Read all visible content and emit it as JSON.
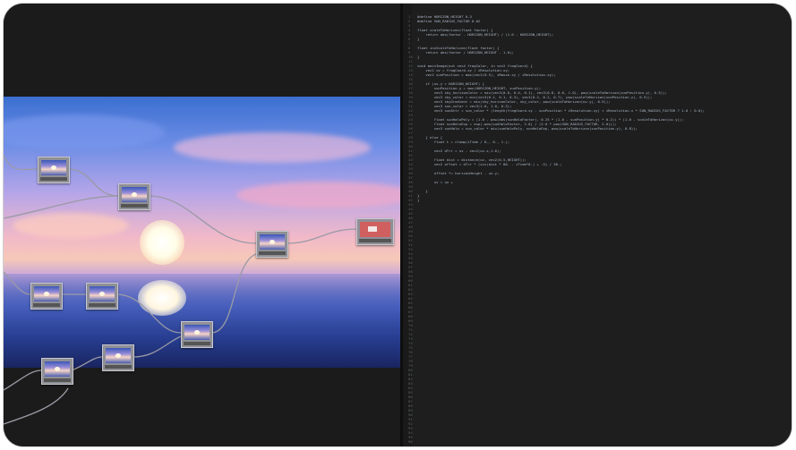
{
  "window": {
    "title": ""
  },
  "editor": {
    "lines": [
      {
        "n": "1",
        "t": "#define HORIZON_HEIGHT 0.3"
      },
      {
        "n": "2",
        "t": "#define SUN_RADIUS_FACTOR 0.02"
      },
      {
        "n": "3",
        "t": ""
      },
      {
        "n": "4",
        "t": "float scaleToHorizon(float factor) {"
      },
      {
        "n": "5",
        "t": "    return abs(factor - HORIZON_HEIGHT) / (1.0 - HORIZON_HEIGHT);"
      },
      {
        "n": "6",
        "t": "}"
      },
      {
        "n": "7",
        "t": ""
      },
      {
        "n": "8",
        "t": "float invScaleToHorizon(float factor) {"
      },
      {
        "n": "9",
        "t": "    return abs(factor / HORIZON_HEIGHT - 1.0);"
      },
      {
        "n": "10",
        "t": "}"
      },
      {
        "n": "11",
        "t": ""
      },
      {
        "n": "12",
        "t": "void mainImage(out vec4 fragColor, in vec2 fragCoord) {"
      },
      {
        "n": "13",
        "t": "    vec2 uv = fragCoord.xy / iResolution.xy;"
      },
      {
        "n": "14",
        "t": "    vec2 sunPosition = max(vec2(0.5), iMouse.xy / iResolution.xy);"
      },
      {
        "n": "15",
        "t": ""
      },
      {
        "n": "16",
        "t": "    if (uv.y > HORIZON_HEIGHT) {"
      },
      {
        "n": "17",
        "t": "        sunPosition.y = max(HORIZON_HEIGHT, sunPosition.y);"
      },
      {
        "n": "18",
        "t": "        vec3 sky_horizonColor = mix(vec3(0.8, 0.4, 0.1), vec3(0.8, 0.6, 1.0), pow(scaleToHorizon(sunPosition.y), 0.5));"
      },
      {
        "n": "19",
        "t": "        vec3 sky_color = mix(vec3(0.1, 0.1, 0.3), vec3(0.2, 0.2, 0.7), pow(scaleToHorizon(sunPosition.y), 0.5));"
      },
      {
        "n": "20",
        "t": "        vec3 skyGradient = mix(sky_horizonColor, sky_color, pow(scaleToHorizon(uv.y), 0.5));"
      },
      {
        "n": "21",
        "t": "        vec3 sun_color = vec3(1.0, 1.0, 0.3);"
      },
      {
        "n": "22",
        "t": "        vec3 sunAttr = sun_color * (length(fragCoord.xy - sunPosition * iResolution.xy) < iResolution.x * SUN_RADIUS_FACTOR ? 1.0 : 0.0);"
      },
      {
        "n": "23",
        "t": ""
      },
      {
        "n": "24",
        "t": "        float sunHaloPoly = (1.0 - pow(abs(sunHaloFactor), 0.25 * (1.0 - sunPosition.y) * 0.2)) * (1.0 - scaleToHorizon(uv.y));"
      },
      {
        "n": "25",
        "t": "        float sunHaloExp = exp(-pow(sunHaloFactor, 2.0) / (2.0 * pow(SUN_RADIUS_FACTOR, 2.0)));"
      },
      {
        "n": "26",
        "t": "        vec3 sunHalo = sun_color * mix(sunHaloPoly, sunHaloExp, pow(scaleToHorizon(sunPosition.y), 0.8));"
      },
      {
        "n": "27",
        "t": ""
      },
      {
        "n": "28",
        "t": "    } else {"
      },
      {
        "n": "29",
        "t": "        float t = clamp(iTime / 6., 0., 1.);"
      },
      {
        "n": "30",
        "t": ""
      },
      {
        "n": "31",
        "t": "        vec2 dTrr = uv - vec2(uv.x,1.0);"
      },
      {
        "n": "32",
        "t": ""
      },
      {
        "n": "33",
        "t": "        float dist = distance(uv, vec2(0.5,HEIGHT));"
      },
      {
        "n": "34",
        "t": "        vec2 offset = dTrr * (sin(dist * 80. - iTime*6.) + .5) / 30.;"
      },
      {
        "n": "35",
        "t": ""
      },
      {
        "n": "36",
        "t": "        offset *= horizonHeight - uv.y;"
      },
      {
        "n": "37",
        "t": ""
      },
      {
        "n": "38",
        "t": "        uv = uv +"
      },
      {
        "n": "39",
        "t": ""
      },
      {
        "n": "40",
        "t": "    }"
      },
      {
        "n": "41",
        "t": "}"
      },
      {
        "n": "42",
        "t": "}"
      }
    ],
    "empty_lines": [
      "43",
      "44",
      "45",
      "46",
      "47",
      "48",
      "49",
      "50",
      "51",
      "52",
      "53",
      "54",
      "55",
      "56",
      "57",
      "58",
      "59",
      "60",
      "61",
      "62",
      "63",
      "64",
      "65",
      "66",
      "67",
      "68",
      "69",
      "70",
      "71",
      "72",
      "73",
      "74",
      "75",
      "76",
      "77",
      "78",
      "79",
      "80",
      "81",
      "82",
      "83",
      "84",
      "85",
      "86",
      "87",
      "88",
      "89",
      "90",
      "91",
      "92",
      "93",
      "94",
      "95",
      "96"
    ]
  },
  "graph": {
    "nodes": [
      {
        "id": "node-1",
        "kind": "image"
      },
      {
        "id": "node-2",
        "kind": "image"
      },
      {
        "id": "node-3",
        "kind": "image"
      },
      {
        "id": "node-4",
        "kind": "output"
      },
      {
        "id": "node-5",
        "kind": "image"
      },
      {
        "id": "node-6",
        "kind": "image"
      },
      {
        "id": "node-7",
        "kind": "image"
      },
      {
        "id": "node-8",
        "kind": "image"
      },
      {
        "id": "node-9",
        "kind": "image"
      }
    ]
  },
  "colors": {
    "background": "#1c1c1c",
    "code_text": "#a9b7c6",
    "line_numbers": "#5f6368",
    "sky_top": "#3b6fd0",
    "sky_mid": "#f2b9c8",
    "sea": "#263c8e"
  }
}
